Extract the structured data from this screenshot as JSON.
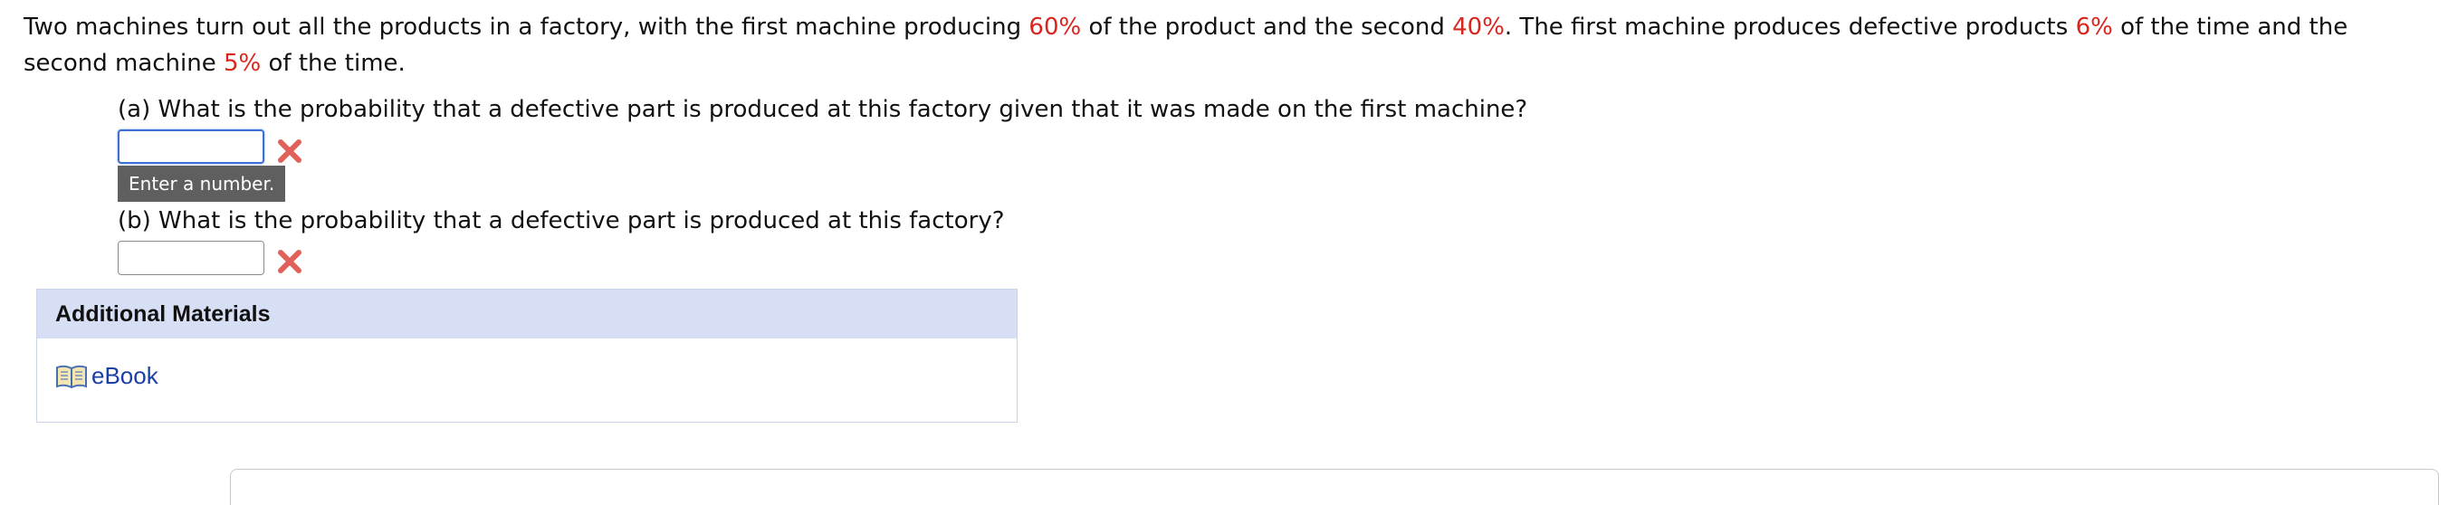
{
  "problem": {
    "t1": "Two machines turn out all the products in a factory, with the first machine producing ",
    "p1": "60%",
    "t2": " of the product and the second ",
    "p2": "40%",
    "t3": ". The first machine produces defective products ",
    "p3": "6%",
    "t4": " of the time and the second machine ",
    "p4": "5%",
    "t5": " of the time."
  },
  "parts": [
    {
      "question": "(a) What is the probability that a defective part is produced at this factory given that it was made on the first machine?",
      "value": "",
      "status": "incorrect"
    },
    {
      "question": "(b) What is the probability that a defective part is produced at this factory?",
      "value": "",
      "status": "incorrect"
    }
  ],
  "tooltip": "Enter a number.",
  "materials": {
    "header": "Additional Materials",
    "link": "eBook"
  },
  "colors": {
    "highlight": "#d8261f",
    "error": "#e0605a",
    "link": "#1a3fa5",
    "header_bg": "#d7dff4"
  },
  "icons": {
    "incorrect": "x-mark-icon",
    "ebook": "book-icon"
  }
}
